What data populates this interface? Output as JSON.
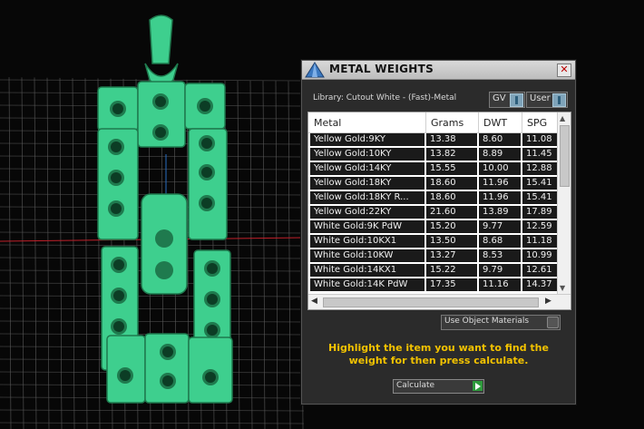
{
  "window": {
    "title": "METAL WEIGHTS",
    "close_glyph": "✕",
    "app_icon": "pyramid-logo-icon"
  },
  "library": {
    "label": "Library: Cutout White - (Fast)-Metal",
    "gv_label": "GV",
    "user_label": "User"
  },
  "table": {
    "columns": [
      "Metal",
      "Grams",
      "DWT",
      "SPG"
    ],
    "rows": [
      [
        "Yellow Gold:9KY",
        "13.38",
        "8.60",
        "11.08"
      ],
      [
        "Yellow Gold:10KY",
        "13.82",
        "8.89",
        "11.45"
      ],
      [
        "Yellow Gold:14KY",
        "15.55",
        "10.00",
        "12.88"
      ],
      [
        "Yellow Gold:18KY",
        "18.60",
        "11.96",
        "15.41"
      ],
      [
        "Yellow Gold:18KY R...",
        "18.60",
        "11.96",
        "15.41"
      ],
      [
        "Yellow Gold:22KY",
        "21.60",
        "13.89",
        "17.89"
      ],
      [
        "White Gold:9K PdW",
        "15.20",
        "9.77",
        "12.59"
      ],
      [
        "White Gold:10KX1",
        "13.50",
        "8.68",
        "11.18"
      ],
      [
        "White Gold:10KW",
        "13.27",
        "8.53",
        "10.99"
      ],
      [
        "White Gold:14KX1",
        "15.22",
        "9.79",
        "12.61"
      ],
      [
        "White Gold:14K PdW",
        "17.35",
        "11.16",
        "14.37"
      ]
    ]
  },
  "use_object_materials": "Use Object Materials",
  "hint": "Highlight the item you want to find the weight for then press calculate.",
  "calculate_label": "Calculate",
  "colors": {
    "model": "#3ecf8e",
    "hint": "#f2c200",
    "grid": "#5a5a5a"
  }
}
